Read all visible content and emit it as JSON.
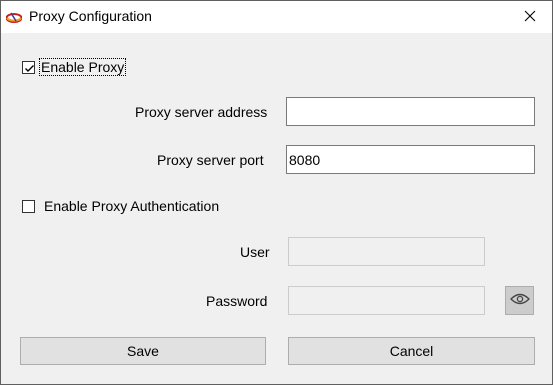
{
  "window": {
    "title": "Proxy Configuration",
    "icon": "app-logo-icon",
    "close_icon": "close-icon"
  },
  "proxy": {
    "enable_label": "Enable Proxy",
    "enable_checked": true,
    "address_label": "Proxy server address",
    "address_value": "",
    "port_label": "Proxy server port",
    "port_value": "8080"
  },
  "auth": {
    "enable_label": "Enable Proxy Authentication",
    "enable_checked": false,
    "user_label": "User",
    "user_value": "",
    "password_label": "Password",
    "password_value": "",
    "reveal_icon": "eye-icon"
  },
  "buttons": {
    "save_label": "Save",
    "cancel_label": "Cancel"
  }
}
